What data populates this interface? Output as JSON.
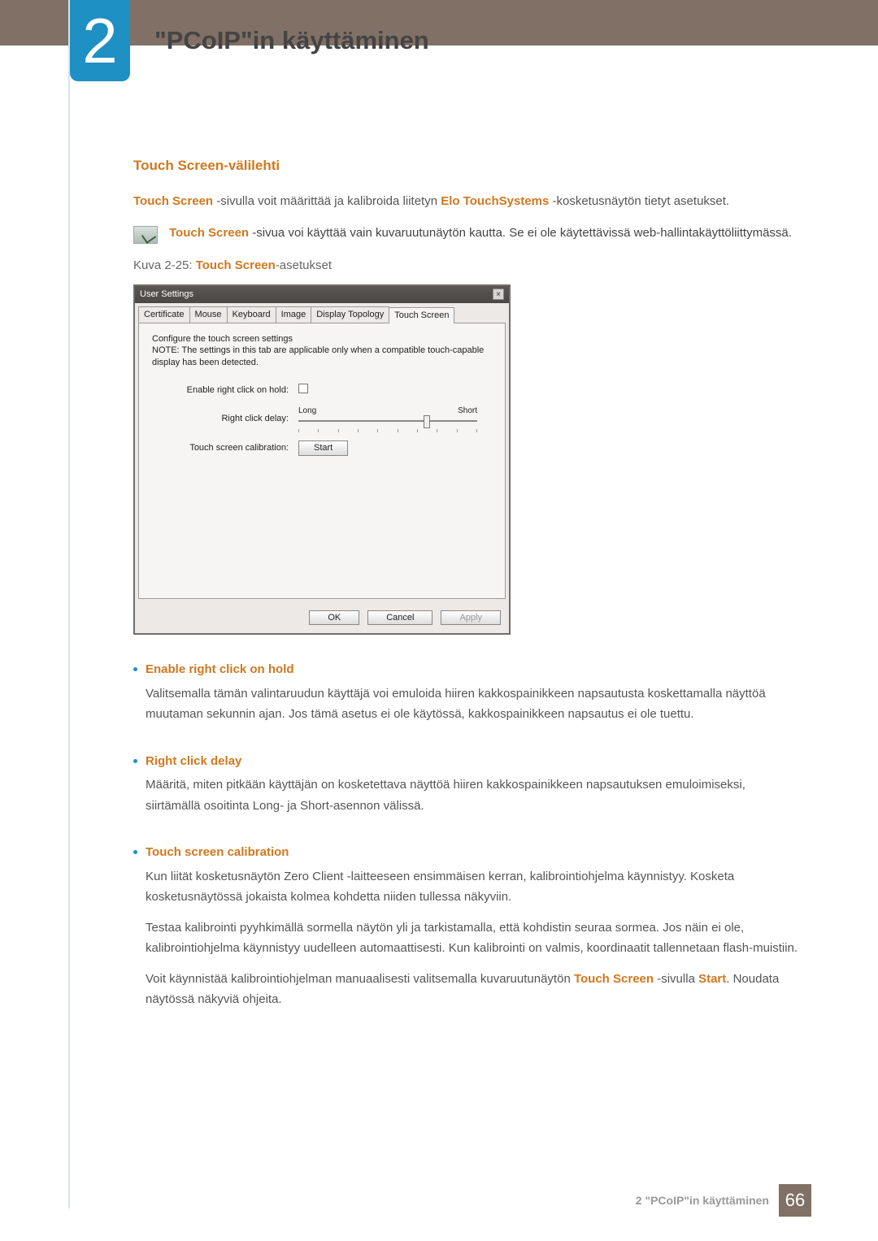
{
  "chapter": {
    "number": "2",
    "title": "\"PCoIP\"in käyttäminen"
  },
  "section": {
    "heading": "Touch Screen-välilehti",
    "intro_part1": "Touch Screen",
    "intro_middle": " -sivulla voit määrittää ja kalibroida liitetyn ",
    "intro_highlight2": "Elo TouchSystems",
    "intro_end": " -kosketusnäytön tietyt asetukset.",
    "note_highlight": "Touch Screen",
    "note_text": " -sivua voi käyttää vain kuvaruutunäytön kautta. Se ei ole käytettävissä web-hallintakäyttöliittymässä.",
    "caption_prefix": "Kuva 2-25: ",
    "caption_highlight": "Touch Screen",
    "caption_suffix": "-asetukset"
  },
  "dialog": {
    "title": "User Settings",
    "close_icon": "×",
    "tabs": [
      "Certificate",
      "Mouse",
      "Keyboard",
      "Image",
      "Display Topology",
      "Touch Screen"
    ],
    "active_tab_index": 5,
    "config_line1": "Configure the touch screen settings",
    "config_line2": "NOTE: The settings in this tab are applicable only when a compatible touch-capable display has been detected.",
    "fields": {
      "enable_label": "Enable right click on hold:",
      "delay_label": "Right click delay:",
      "delay_left": "Long",
      "delay_right": "Short",
      "calib_label": "Touch screen calibration:",
      "start_btn": "Start"
    },
    "buttons": {
      "ok": "OK",
      "cancel": "Cancel",
      "apply": "Apply"
    }
  },
  "bullets": [
    {
      "title": "Enable right click on hold",
      "paras": [
        "Valitsemalla tämän valintaruudun käyttäjä voi emuloida hiiren kakkospainikkeen napsautusta koskettamalla näyttöä muutaman sekunnin ajan. Jos tämä asetus ei ole käytössä, kakkospainikkeen napsautus ei ole tuettu."
      ]
    },
    {
      "title": "Right click delay",
      "paras": [
        "Määritä, miten pitkään käyttäjän on kosketettava näyttöä hiiren kakkospainikkeen napsautuksen emuloimiseksi, siirtämällä osoitinta Long- ja Short-asennon välissä."
      ]
    },
    {
      "title": "Touch screen calibration",
      "paras": [
        "Kun liität kosketusnäytön Zero Client -laitteeseen ensimmäisen kerran, kalibrointiohjelma käynnistyy. Kosketa kosketusnäytössä jokaista kolmea kohdetta niiden tullessa näkyviin.",
        "Testaa kalibrointi pyyhkimällä sormella näytön yli ja tarkistamalla, että kohdistin seuraa sormea. Jos näin ei ole, kalibrointiohjelma käynnistyy uudelleen automaattisesti. Kun kalibrointi on valmis, koordinaatit tallennetaan flash-muistiin."
      ],
      "last_para_prefix": "Voit käynnistää kalibrointiohjelman manuaalisesti valitsemalla kuvaruutunäytön ",
      "last_h1": "Touch Screen",
      "last_middle": " -sivulla ",
      "last_h2": "Start",
      "last_suffix": ". Noudata näytössä näkyviä ohjeita."
    }
  ],
  "footer": {
    "text": "2 \"PCoIP\"in käyttäminen",
    "page": "66"
  }
}
